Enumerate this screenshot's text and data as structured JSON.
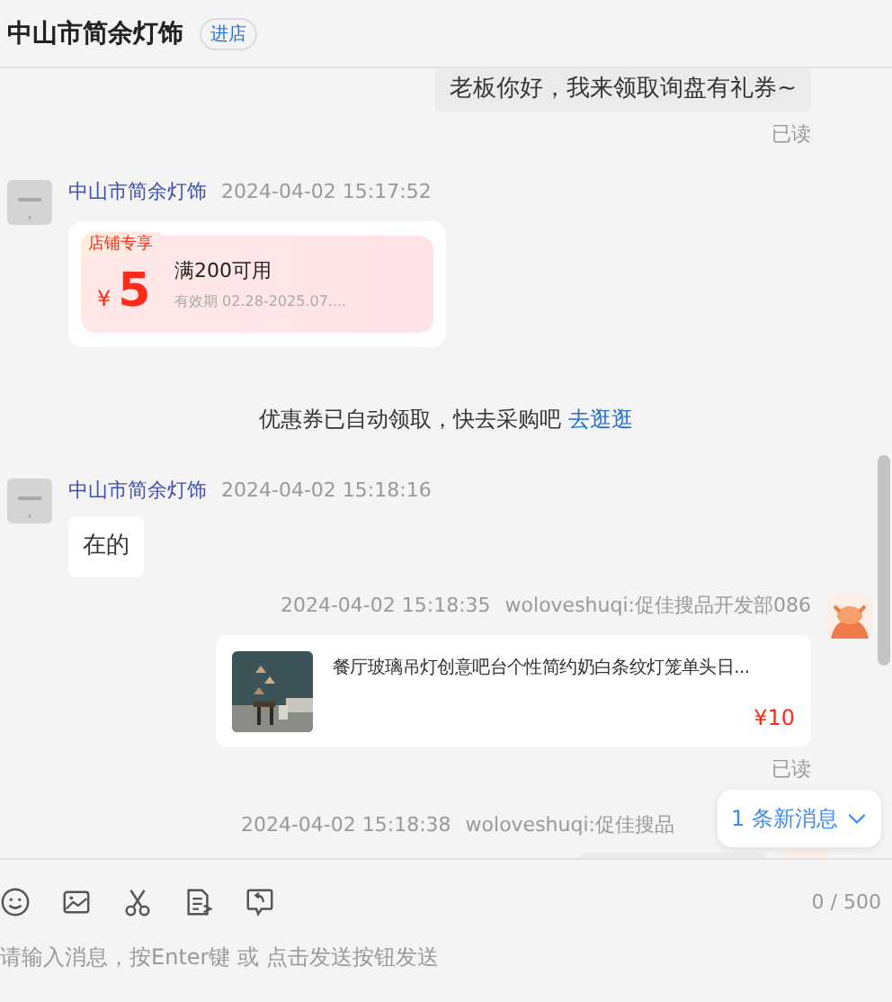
{
  "header": {
    "title": "中山市简余灯饰",
    "badge": "进店"
  },
  "messages": [
    {
      "kind": "outgoing_text",
      "text": "老板你好，我来领取询盘有礼券~",
      "read_label": "已读"
    },
    {
      "kind": "incoming_coupon",
      "sender": "中山市简余灯饰",
      "time": "2024-04-02 15:17:52",
      "coupon": {
        "tag": "店铺专享",
        "currency": "¥",
        "amount": "5",
        "condition": "满200可用",
        "validity": "有效期 02.28-2025.07...."
      }
    },
    {
      "kind": "system",
      "text": "优惠券已自动领取，快去采购吧",
      "link": "去逛逛"
    },
    {
      "kind": "incoming_text",
      "sender": "中山市简余灯饰",
      "time": "2024-04-02 15:18:16",
      "text": "在的"
    },
    {
      "kind": "outgoing_product",
      "time": "2024-04-02 15:18:35",
      "sender": "woloveshuqi:促佳搜品开发部086",
      "product": {
        "title": "餐厅玻璃吊灯创意吧台个性简约奶白条纹灯笼单头日...",
        "price": "¥10"
      },
      "read_label": "已读"
    },
    {
      "kind": "outgoing_partial",
      "time": "2024-04-02 15:18:38",
      "sender": "woloveshuqi:促佳搜品"
    }
  ],
  "new_messages": {
    "label": "1 条新消息"
  },
  "composer": {
    "counter": "0 / 500",
    "placeholder": "请输入消息，按Enter键 或 点击发送按钮发送"
  }
}
